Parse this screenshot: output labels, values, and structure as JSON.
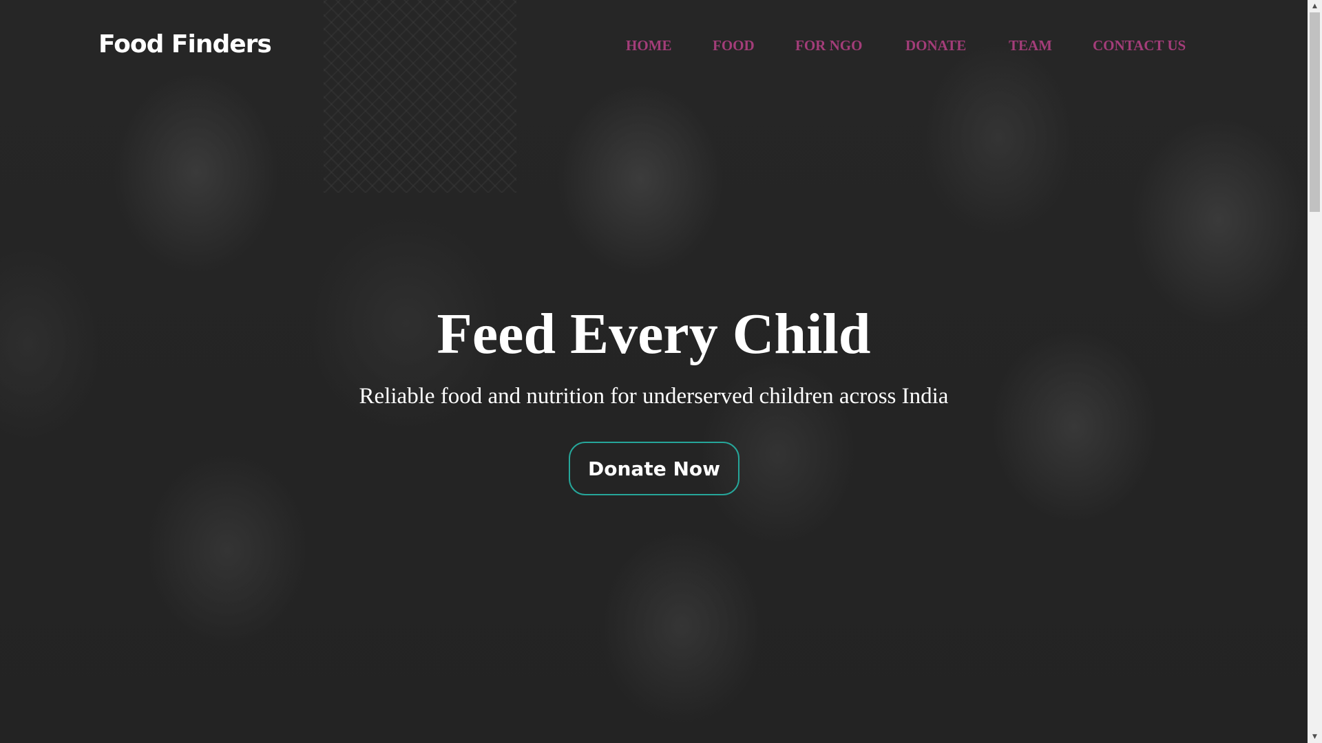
{
  "brand": {
    "name": "Food Finders"
  },
  "nav": {
    "items": [
      {
        "label": "HOME"
      },
      {
        "label": "FOOD"
      },
      {
        "label": "FOR NGO"
      },
      {
        "label": "DONATE"
      },
      {
        "label": "TEAM"
      },
      {
        "label": "CONTACT US"
      }
    ]
  },
  "hero": {
    "title": "Feed Every Child",
    "subtitle": "Reliable food and nutrition for underserved children across India",
    "cta_label": "Donate Now"
  },
  "scrollbar": {
    "up_icon": "▲",
    "down_icon": "▼"
  },
  "colors": {
    "nav_link": "#a33d79",
    "cta_border": "#26a69a",
    "text": "#ffffff"
  }
}
